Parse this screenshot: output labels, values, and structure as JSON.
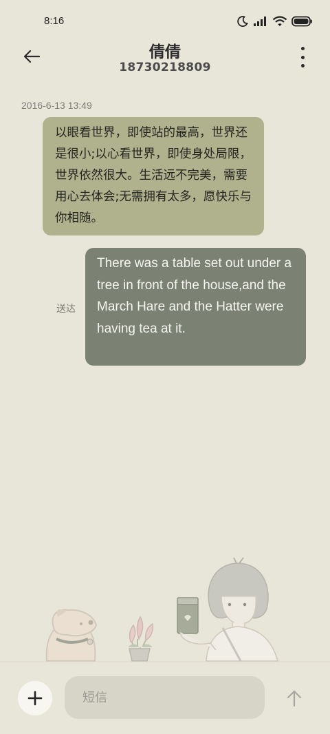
{
  "status_bar": {
    "time": "8:16"
  },
  "header": {
    "contact_name": "倩倩",
    "contact_number": "18730218809"
  },
  "conversation": {
    "timestamp": "2016-6-13 13:49",
    "messages": [
      {
        "direction": "incoming",
        "text": "以眼看世界，即使站的最高，世界还是很小;以心看世界，即使身处局限，世界依然很大。生活远不完美，需要用心去体会;无需拥有太多，愿快乐与你相随。"
      },
      {
        "direction": "outgoing",
        "text": "There was a table set out under a tree in front of the house,and the March Hare and the Hatter were having tea at it.",
        "status": "送达"
      }
    ]
  },
  "composer": {
    "placeholder": "短信",
    "value": ""
  },
  "colors": {
    "background": "#e8e5d9",
    "incoming_bubble": "#b0b28e",
    "outgoing_bubble": "#7c8273",
    "input_background": "#d7d4c8"
  },
  "icons": {
    "back": "arrow-left-icon",
    "more": "more-vertical-icon",
    "add": "plus-icon",
    "send": "arrow-up-icon",
    "status": [
      "moon-icon",
      "signal-icon",
      "wifi-icon",
      "battery-icon"
    ]
  }
}
